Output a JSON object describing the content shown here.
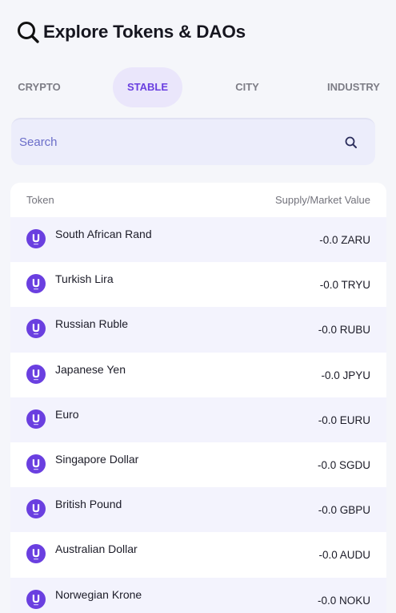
{
  "header": {
    "title": "Explore Tokens & DAOs",
    "icon": "search-icon"
  },
  "tabs": [
    {
      "label": "CRYPTO",
      "active": false
    },
    {
      "label": "STABLE",
      "active": true
    },
    {
      "label": "CITY",
      "active": false
    },
    {
      "label": "INDUSTRY",
      "active": false
    }
  ],
  "search": {
    "placeholder": "Search",
    "value": ""
  },
  "table": {
    "col_token": "Token",
    "col_supply": "Supply/Market Value",
    "rows": [
      {
        "name": "South African Rand",
        "value": "-0.0 ZARU"
      },
      {
        "name": "Turkish Lira",
        "value": "-0.0 TRYU"
      },
      {
        "name": "Russian Ruble",
        "value": "-0.0 RUBU"
      },
      {
        "name": "Japanese Yen",
        "value": "-0.0 JPYU"
      },
      {
        "name": "Euro",
        "value": "-0.0 EURU"
      },
      {
        "name": "Singapore Dollar",
        "value": "-0.0 SGDU"
      },
      {
        "name": "British Pound",
        "value": "-0.0 GBPU"
      },
      {
        "name": "Australian Dollar",
        "value": "-0.0 AUDU"
      },
      {
        "name": "Norwegian Krone",
        "value": "-0.0 NOKU"
      }
    ]
  },
  "colors": {
    "accent": "#6a3fe0",
    "tab_active_bg": "#eae6fb",
    "search_bg": "#ecedfb",
    "row_alt_bg": "#f3f3fd"
  }
}
